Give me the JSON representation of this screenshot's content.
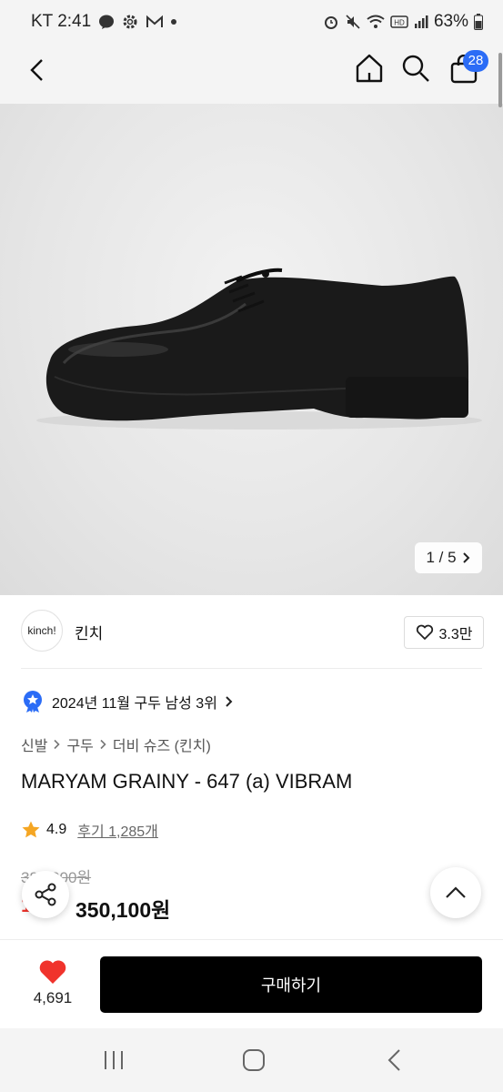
{
  "status_bar": {
    "carrier_time": "KT 2:41",
    "battery": "63%"
  },
  "header": {
    "cart_count": "28"
  },
  "gallery": {
    "counter": "1 / 5"
  },
  "brand": {
    "logo_text": "kinch!",
    "name": "킨치",
    "likes": "3.3만"
  },
  "ranking": {
    "text": "2024년 11월 구두 남성 3위"
  },
  "breadcrumb": [
    "신발",
    "구두",
    "더비 슈즈 (킨치)"
  ],
  "product": {
    "title": "MARYAM GRAINY - 647 (a) VIBRAM",
    "rating": "4.9",
    "reviews": "후기 1,285개",
    "original_price": "389,000원",
    "discount": "10%",
    "price": "350,100원"
  },
  "bottom": {
    "heart_count": "4,691",
    "buy_label": "구매하기"
  },
  "colors": {
    "accent": "#2b6cf6",
    "discount": "#f0332c",
    "heart": "#f0332c",
    "star": "#f5a623"
  },
  "icons": [
    "back-icon",
    "home-icon",
    "search-icon",
    "cart-icon",
    "chevron-right-icon",
    "heart-outline-icon",
    "rank-badge-icon",
    "star-icon",
    "share-icon",
    "chevron-up-icon",
    "heart-filled-icon",
    "recents-icon",
    "home-nav-icon",
    "back-nav-icon"
  ]
}
